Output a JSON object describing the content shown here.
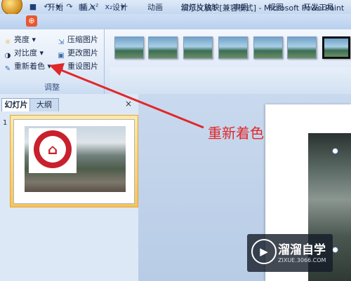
{
  "window": {
    "title": "演示文稿1 [兼容模式] - Microsoft PowerPoint"
  },
  "ribbon_tabs": [
    "开始",
    "插入",
    "设计",
    "动画",
    "幻灯片放映",
    "审阅",
    "视图",
    "开发工具"
  ],
  "adjust_group": {
    "brightness": "亮度 ▾",
    "contrast": "对比度 ▾",
    "recolor": "重新着色 ▾",
    "compress": "压缩图片",
    "change_picture": "更改图片",
    "reset_picture": "重设图片",
    "label": "调整"
  },
  "picture_styles": {
    "count": 8,
    "selected_index": 7
  },
  "left_pane": {
    "tab_slides": "幻灯片",
    "tab_outline": "大纲",
    "close": "×",
    "slide_number": "1"
  },
  "annotation": {
    "text": "重新着色",
    "color": "#e0282a"
  },
  "watermark": {
    "name": "溜溜自学",
    "url": "ZIXUE.3066.COM"
  },
  "colors": {
    "ribbon_bg": "#dae6f6",
    "accent_red": "#c8202c",
    "selection": "#f7c45a"
  }
}
